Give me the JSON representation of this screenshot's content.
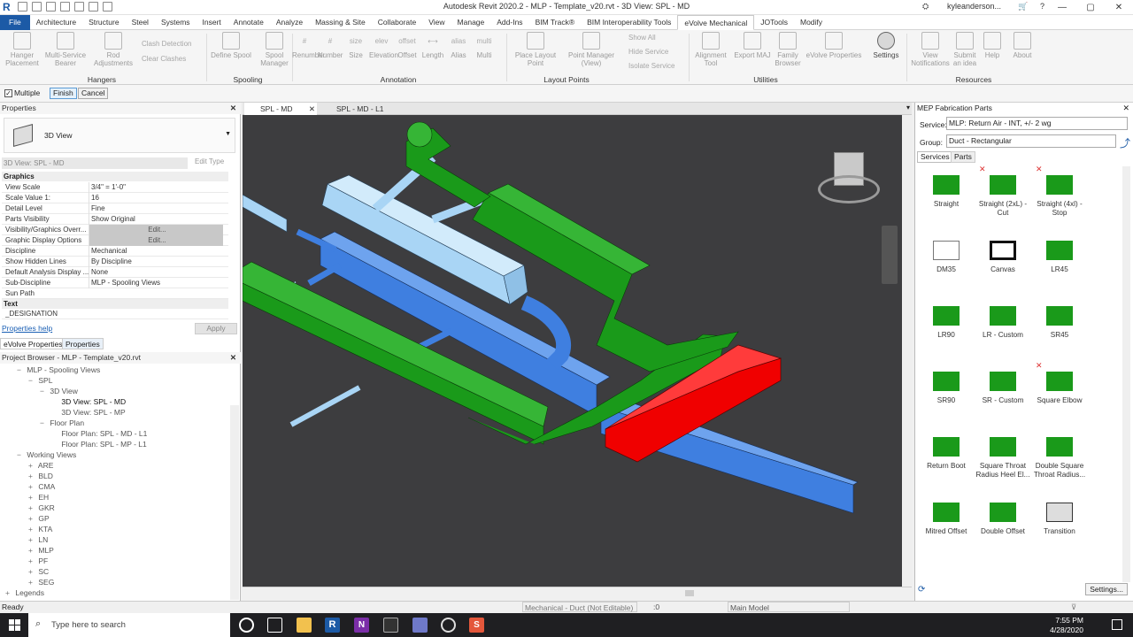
{
  "app_title": "Autodesk Revit 2020.2 - MLP - Template_v20.rvt - 3D View: SPL - MD",
  "user": "kyleanderson...",
  "menu_tabs": [
    "File",
    "Architecture",
    "Structure",
    "Steel",
    "Systems",
    "Insert",
    "Annotate",
    "Analyze",
    "Massing & Site",
    "Collaborate",
    "View",
    "Manage",
    "Add-Ins",
    "BIM Track®",
    "BIM Interoperability Tools",
    "eVolve Mechanical",
    "JOTools",
    "Modify"
  ],
  "active_tab": "eVolve Mechanical",
  "ribbon": {
    "hangers": {
      "label": "Hangers",
      "buttons": [
        "Hanger Placement",
        "Multi-Service Bearer",
        "Rod Adjustments"
      ],
      "small": [
        "Clash Detection",
        "Clear Clashes"
      ]
    },
    "spooling": {
      "label": "Spooling",
      "buttons": [
        "Define Spool",
        "Spool Manager"
      ]
    },
    "annotation": {
      "label": "Annotation",
      "buttons": [
        "Renumber",
        "Number",
        "Size",
        "Elevation",
        "Offset",
        "Length",
        "Alias",
        "Multi"
      ],
      "icon_text": [
        "#",
        "#",
        "size",
        "elev",
        "offset",
        "⟷",
        "alias",
        "multi"
      ]
    },
    "layout": {
      "label": "Layout Points",
      "buttons": [
        "Place Layout Point",
        "Point Manager (View)"
      ],
      "small": [
        "Show All",
        "Hide Service",
        "Isolate Service"
      ]
    },
    "utilities": {
      "label": "Utilities",
      "buttons": [
        "Alignment Tool",
        "Export MAJ",
        "Family Browser",
        "eVolve Properties",
        "Settings"
      ]
    },
    "resources": {
      "label": "Resources",
      "buttons": [
        "View Notifications",
        "Submit an idea",
        "Help",
        "About"
      ]
    }
  },
  "options_bar": {
    "multiple_label": "Multiple",
    "finish": "Finish",
    "cancel": "Cancel"
  },
  "properties": {
    "header": "Properties",
    "type_name": "3D View",
    "selector": "3D View: SPL - MD",
    "edit_type": "Edit Type",
    "section_graphics": "Graphics",
    "rows": [
      {
        "k": "View Scale",
        "v": "3/4\" = 1'-0\""
      },
      {
        "k": "Scale Value    1:",
        "v": "16"
      },
      {
        "k": "Detail Level",
        "v": "Fine"
      },
      {
        "k": "Parts Visibility",
        "v": "Show Original"
      },
      {
        "k": "Visibility/Graphics Overr...",
        "v": "Edit..."
      },
      {
        "k": "Graphic Display Options",
        "v": "Edit..."
      },
      {
        "k": "Discipline",
        "v": "Mechanical"
      },
      {
        "k": "Show Hidden Lines",
        "v": "By Discipline"
      },
      {
        "k": "Default Analysis Display ...",
        "v": "None"
      },
      {
        "k": "Sub-Discipline",
        "v": "MLP - Spooling Views"
      },
      {
        "k": "Sun Path",
        "v": ""
      }
    ],
    "section_text": "Text",
    "designation": "_DESIGNATION",
    "help_link": "Properties help",
    "apply": "Apply"
  },
  "bottom_tabs": [
    "eVolve Properties",
    "Properties"
  ],
  "project_browser": {
    "header": "Project Browser - MLP - Template_v20.rvt",
    "items": [
      {
        "t": "MLP - Spooling Views",
        "lvl": 1,
        "exp": "−"
      },
      {
        "t": "SPL",
        "lvl": 2,
        "exp": "−"
      },
      {
        "t": "3D View",
        "lvl": 3,
        "exp": "−"
      },
      {
        "t": "3D View: SPL - MD",
        "lvl": 4,
        "bold": true
      },
      {
        "t": "3D View: SPL - MP",
        "lvl": 4
      },
      {
        "t": "Floor Plan",
        "lvl": 3,
        "exp": "−"
      },
      {
        "t": "Floor Plan: SPL - MD - L1",
        "lvl": 4
      },
      {
        "t": "Floor Plan: SPL - MP - L1",
        "lvl": 4
      },
      {
        "t": "Working Views",
        "lvl": 1,
        "exp": "−"
      },
      {
        "t": "ARE",
        "lvl": 2,
        "exp": "+"
      },
      {
        "t": "BLD",
        "lvl": 2,
        "exp": "+"
      },
      {
        "t": "CMA",
        "lvl": 2,
        "exp": "+"
      },
      {
        "t": "EH",
        "lvl": 2,
        "exp": "+"
      },
      {
        "t": "GKR",
        "lvl": 2,
        "exp": "+"
      },
      {
        "t": "GP",
        "lvl": 2,
        "exp": "+"
      },
      {
        "t": "KTA",
        "lvl": 2,
        "exp": "+"
      },
      {
        "t": "LN",
        "lvl": 2,
        "exp": "+"
      },
      {
        "t": "MLP",
        "lvl": 2,
        "exp": "+"
      },
      {
        "t": "PF",
        "lvl": 2,
        "exp": "+"
      },
      {
        "t": "SC",
        "lvl": 2,
        "exp": "+"
      },
      {
        "t": "SEG",
        "lvl": 2,
        "exp": "+"
      },
      {
        "t": "Legends",
        "lvl": 0,
        "exp": "+"
      }
    ]
  },
  "view_tabs": [
    "SPL - MD",
    "SPL - MD - L1"
  ],
  "fab_panel": {
    "header": "MEP Fabrication Parts",
    "service_label": "Service:",
    "service_value": "MLP: Return Air - INT, +/- 2 wg",
    "group_label": "Group:",
    "group_value": "Duct - Rectangular",
    "tabs": [
      "Services",
      "Parts"
    ],
    "parts": [
      {
        "n": "Straight",
        "x": false
      },
      {
        "n": "Straight (2xL) - Cut",
        "x": true
      },
      {
        "n": "Straight (4xl) - Stop",
        "x": true
      },
      {
        "n": "DM35",
        "x": false
      },
      {
        "n": "Canvas",
        "x": false
      },
      {
        "n": "LR45",
        "x": false
      },
      {
        "n": "LR90",
        "x": false
      },
      {
        "n": "LR - Custom",
        "x": false
      },
      {
        "n": "SR45",
        "x": false
      },
      {
        "n": "SR90",
        "x": false
      },
      {
        "n": "SR - Custom",
        "x": false
      },
      {
        "n": "Square Elbow",
        "x": true
      },
      {
        "n": "Return Boot",
        "x": false
      },
      {
        "n": "Square Throat Radius Heel El...",
        "x": false
      },
      {
        "n": "Double Square Throat Radius...",
        "x": false
      },
      {
        "n": "Mitred Offset",
        "x": false
      },
      {
        "n": "Double Offset",
        "x": false
      },
      {
        "n": "Transition",
        "x": false
      }
    ],
    "settings": "Settings..."
  },
  "status": {
    "left": "Ready",
    "type": "Mechanical - Duct (Not Editable)",
    "zero": ":0",
    "model": "Main Model"
  },
  "taskbar": {
    "search": "Type here to search",
    "time": "7:55 PM",
    "date": "4/28/2020"
  },
  "colors": {
    "green": "#1a9a1a",
    "blue": "#3f7fe0",
    "light_blue": "#a9d5f5",
    "red": "#f00000",
    "viewport": "#3d3d3f"
  }
}
